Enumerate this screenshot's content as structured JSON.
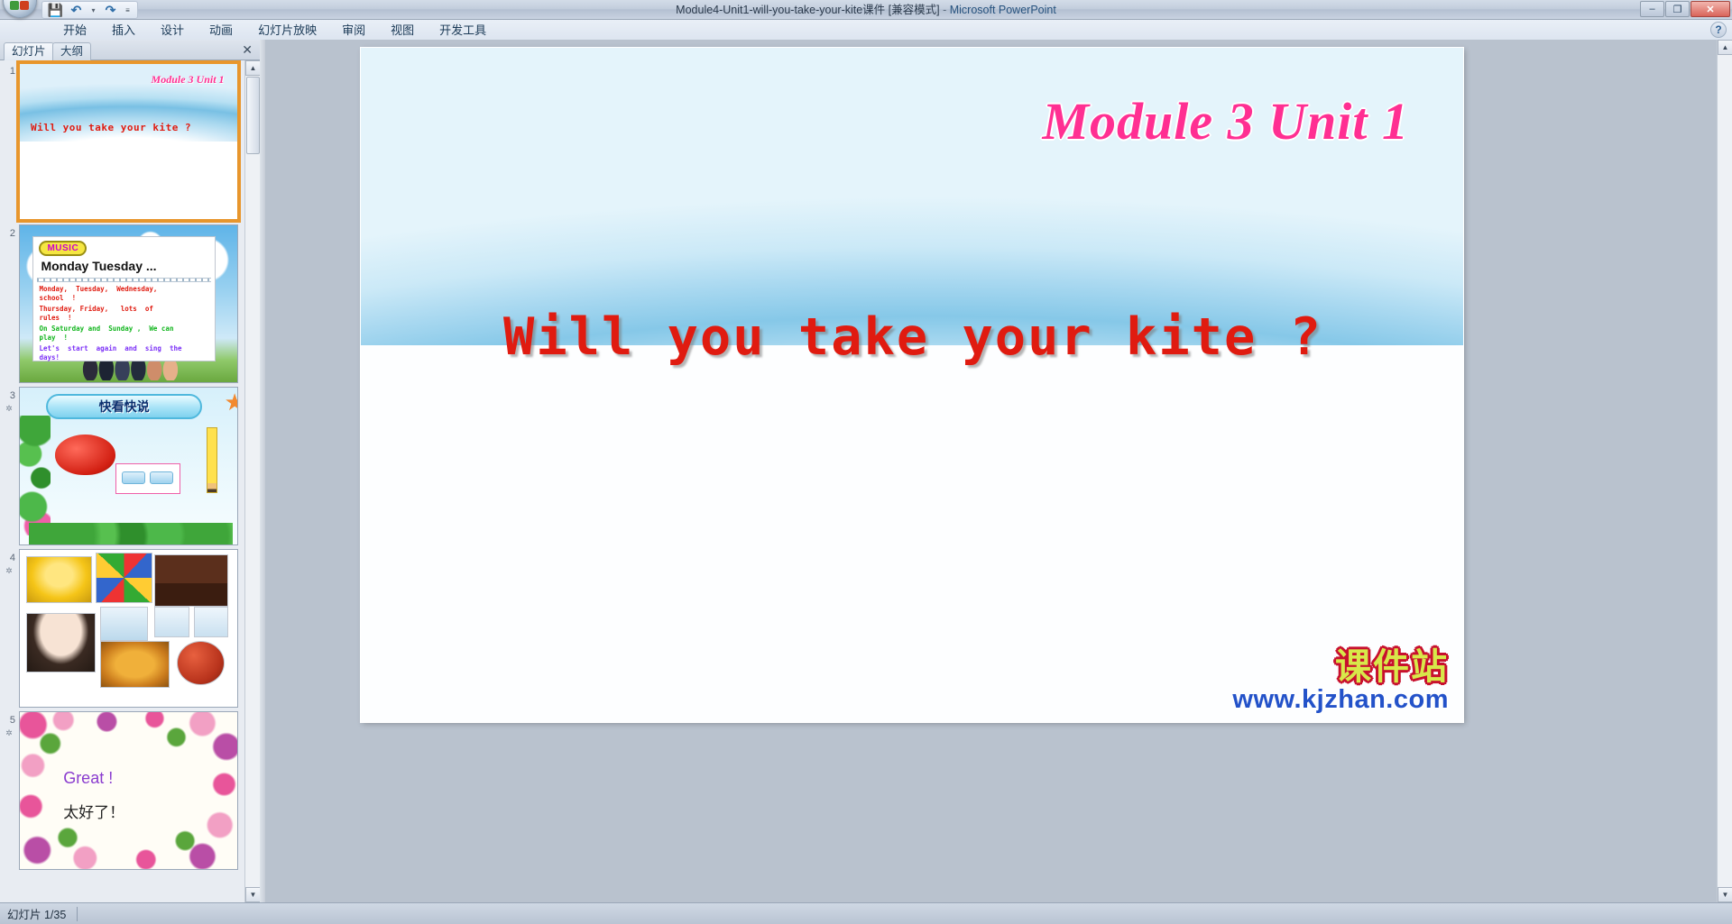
{
  "window": {
    "title_file": "Module4-Unit1-will-you-take-your-kite课件 [兼容模式]",
    "title_sep": " - ",
    "title_app": "Microsoft PowerPoint",
    "minimize": "–",
    "maximize": "❐",
    "close": "✕"
  },
  "quick_access": {
    "office_button": "office-orb",
    "save": "💾",
    "undo": "↶",
    "undo_dropdown": "▾",
    "redo": "↷",
    "customize": "≡"
  },
  "ribbon": {
    "tabs": [
      {
        "label": "开始"
      },
      {
        "label": "插入"
      },
      {
        "label": "设计"
      },
      {
        "label": "动画"
      },
      {
        "label": "幻灯片放映"
      },
      {
        "label": "审阅"
      },
      {
        "label": "视图"
      },
      {
        "label": "开发工具"
      }
    ],
    "help": "?"
  },
  "left_pane": {
    "tabs": [
      {
        "label": "幻灯片"
      },
      {
        "label": "大纲"
      }
    ],
    "close": "✕",
    "scroll_up": "▲",
    "scroll_down": "▼",
    "thumbnails": [
      {
        "number": "1",
        "selected": true,
        "title": "Module 3  Unit 1",
        "body": "Will you take your kite ?"
      },
      {
        "number": "2",
        "selected": false,
        "badge": "MUSIC",
        "heading": "Monday   Tuesday ...",
        "line1": "Monday,  Tuesday,  Wednesday,\nschool  !",
        "line2": "Thursday, Friday,   lots  of\nrules  !",
        "line3": "On Saturday and  Sunday ,  We can\nplay  !",
        "line4": "Let's  start  again  and  sing  the\ndays!"
      },
      {
        "number": "3",
        "selected": false,
        "anim_marker": "✲",
        "heading": "快看快说"
      },
      {
        "number": "4",
        "selected": false,
        "anim_marker": "✲"
      },
      {
        "number": "5",
        "selected": false,
        "anim_marker": "✲",
        "great": "Great !",
        "cn": "太好了！"
      }
    ]
  },
  "slide": {
    "title": "Module 3  Unit 1",
    "body": "Will you take your kite ?",
    "watermark_cn": "课件站",
    "watermark_url": "www.kjzhan.com",
    "scroll_up": "▲",
    "scroll_down": "▼"
  },
  "status_bar": {
    "slide_counter": "幻灯片 1/35"
  },
  "colors": {
    "accent_pink": "#ff2f92",
    "body_red": "#e01b10",
    "selection_orange": "#e8962c",
    "watermark_yellow": "#d8e84a",
    "watermark_blue": "#2352c9"
  }
}
